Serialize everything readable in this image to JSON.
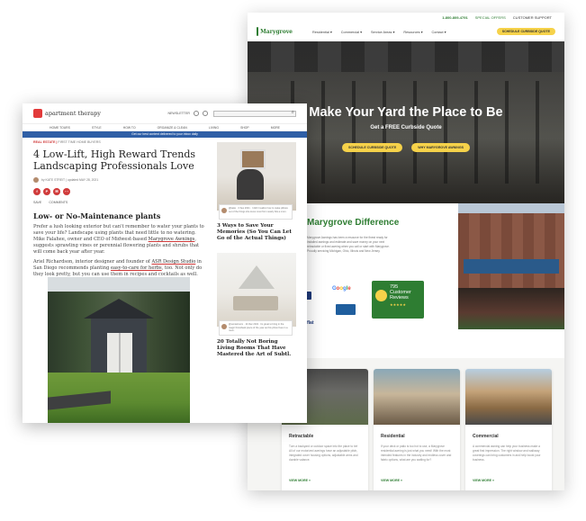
{
  "marygrove": {
    "topbar": {
      "phone": "1-800-809-4791",
      "special_offers": "SPECIAL OFFERS",
      "customer_support": "CUSTOMER SUPPORT"
    },
    "logo_text": "Marygrove",
    "nav": [
      "Residential",
      "Commercial",
      "Service Areas",
      "Resources",
      "Contact"
    ],
    "nav_button": "SCHEDULE CURBSIDE QUOTE",
    "hero": {
      "title": "Make Your Yard the Place to Be",
      "subtitle": "Get a FREE Curbside Quote",
      "btn_primary": "SCHEDULE CURBSIDE QUOTE",
      "btn_secondary": "WHY MARYGROVE AWNINGS"
    },
    "difference": {
      "title": "Marygrove Difference",
      "text": "Marygrove Awnings has been a resource for the finest ready for installed awnings and estimate and save money on your next retractable or fixed awning when you call or start with Marygrove. Proudly servicing Michigan, Ohio, Illinois and New Jersey.",
      "google": [
        "G",
        "o",
        "o",
        "g",
        "l",
        "e"
      ],
      "reviews_count": "795",
      "reviews_label": "Customer Reviews",
      "stars": "★★★★★",
      "left_label": "flat"
    },
    "cards": [
      {
        "title": "Retractable",
        "text": "Turn a backyard or outdoor space into the place to be! All of our motorized awnings have an adjustable pitch, integrated cover housing options, adjustable arms and durable valance.",
        "link": "VIEW MORE »"
      },
      {
        "title": "Residential",
        "text": "If your deck or patio is too hot to use, a Marygrove residential awning is just what you need! With the most intended features in the industry and endless cover and fabric options, what are you waiting for?",
        "link": "VIEW MORE »"
      },
      {
        "title": "Commercial",
        "text": "A commercial awning can help your business make a great first impression. The right window and walkway coverings can bring customers in and help boost your business.",
        "link": "VIEW MORE »"
      }
    ]
  },
  "apartment_therapy": {
    "logo_text": "apartment therapy",
    "newsletter": "NEWSLETTER",
    "menu": [
      "HOME TOURS",
      "STYLE",
      "HOW TO",
      "ORGANIZE & CLEAN",
      "LIVING",
      "SHOP",
      "MORE"
    ],
    "banner": "Get our best content delivered to your inbox daily",
    "category": "REAL ESTATE",
    "category_sub": "FIRST TIME HOME BUYERS",
    "title": "4 Low-Lift, High Reward Trends Landscaping Professionals Love",
    "author": "by KATE STREIT | updated MAY 28, 2021",
    "share": [
      "f",
      "P",
      "✉",
      "⋯"
    ],
    "actions": [
      "SAVE",
      "COMMENTS"
    ],
    "section_heading": "Low- or No-Maintenance plants",
    "para1_start": "Prefer a lush looking exterior but can't remember to water your plants to save your life? Landscape using plants that need little to no watering. Mike Falahee, owner and CEO of Midwest-based ",
    "para1_link": "Marygrove Awnings",
    "para1_end": ", suggests sprawling vines or perennial flowering plants and shrubs that will come back year after year.",
    "para2_start": "Ariel Richardson, interior designer and founder of ",
    "para2_link1": "ASR Design Studio",
    "para2_mid": " in San Diego recommends planting ",
    "para2_link2": "easy-to-care for herbs",
    "para2_end": ", too. Not only do they look pretty, but you can use them in recipes and cocktails as well.",
    "sidebar": [
      {
        "note": "@katie · 3 Sep 2021 · I didn't realize how to make pillows out of the things she loves most from nearly bits a mom.",
        "title": "3 Ways to Save Your Memories (So You Can Let Go of the Actual Things)"
      },
      {
        "note": "@sunsetroom · 14 Dec 2021 · Its great to bring in the magic throwback piece of the year as this photo lives in a room.",
        "title": "20 Totally Not Boring Living Rooms That Have Mastered the Art of Subtl."
      }
    ]
  }
}
